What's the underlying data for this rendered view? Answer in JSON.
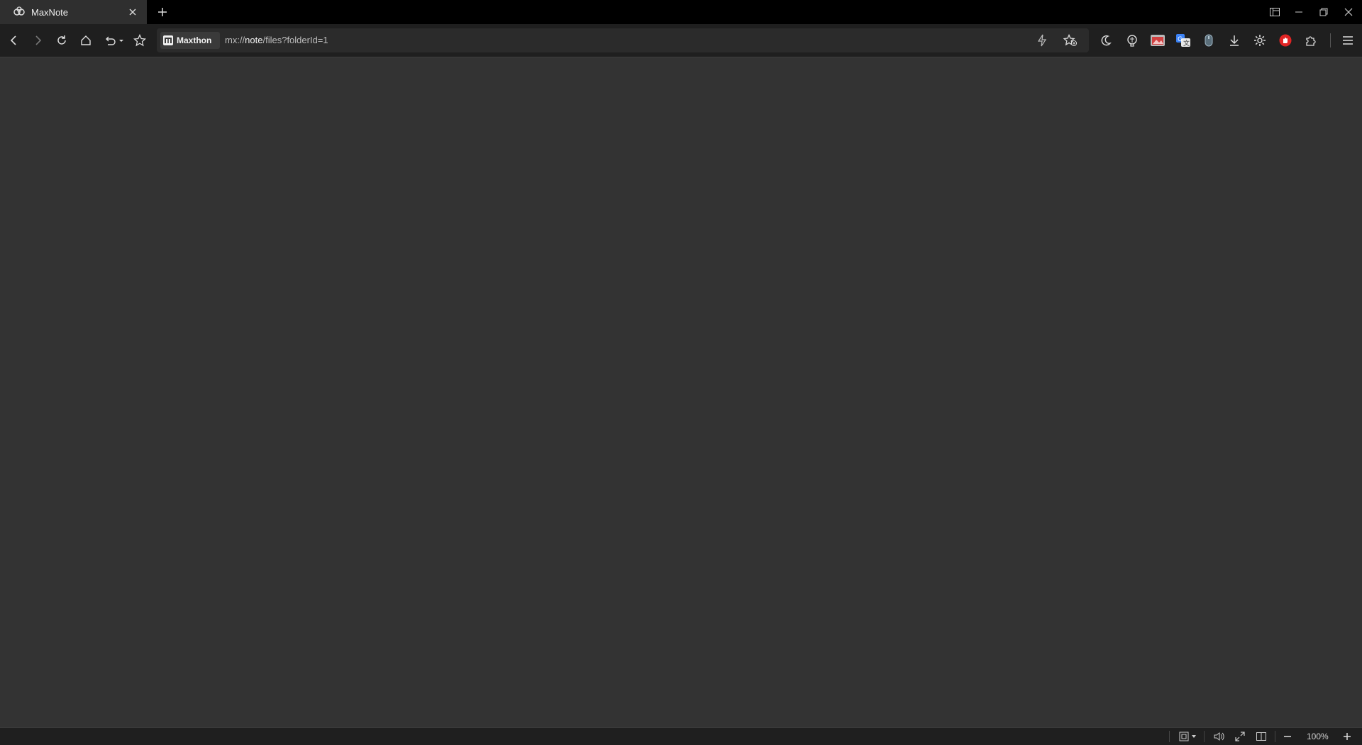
{
  "tab": {
    "title": "MaxNote"
  },
  "address_bar": {
    "brand_label": "Maxthon",
    "url_prefix": "mx://",
    "url_host": "note",
    "url_path": "/files?folderId=1"
  },
  "status_bar": {
    "zoom_level": "100%"
  },
  "icons": {
    "favicon": "maxnote-icon",
    "close_tab": "close-icon",
    "new_tab": "plus-icon",
    "back": "back-arrow-icon",
    "forward": "forward-arrow-icon",
    "reload": "reload-icon",
    "home": "home-icon",
    "undo": "undo-icon",
    "favorites": "star-icon",
    "brand": "maxthon-logo-icon",
    "quick": "lightning-icon",
    "add_favorite": "star-add-icon",
    "night_mode": "moon-icon",
    "extensions": "puzzle-icon",
    "download": "download-icon",
    "menu": "hamburger-icon"
  },
  "colors": {
    "page_background": "#333333",
    "toolbar": "#1f1f1f",
    "tabstrip": "#000000",
    "active_tab": "#2f2f2f",
    "adblock_red": "#e02424"
  }
}
